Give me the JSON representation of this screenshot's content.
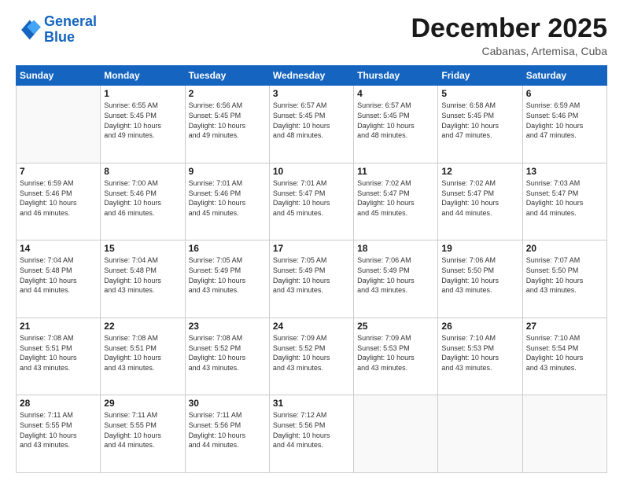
{
  "header": {
    "logo_line1": "General",
    "logo_line2": "Blue",
    "month": "December 2025",
    "location": "Cabanas, Artemisa, Cuba"
  },
  "weekdays": [
    "Sunday",
    "Monday",
    "Tuesday",
    "Wednesday",
    "Thursday",
    "Friday",
    "Saturday"
  ],
  "weeks": [
    [
      {
        "day": "",
        "info": ""
      },
      {
        "day": "1",
        "info": "Sunrise: 6:55 AM\nSunset: 5:45 PM\nDaylight: 10 hours\nand 49 minutes."
      },
      {
        "day": "2",
        "info": "Sunrise: 6:56 AM\nSunset: 5:45 PM\nDaylight: 10 hours\nand 49 minutes."
      },
      {
        "day": "3",
        "info": "Sunrise: 6:57 AM\nSunset: 5:45 PM\nDaylight: 10 hours\nand 48 minutes."
      },
      {
        "day": "4",
        "info": "Sunrise: 6:57 AM\nSunset: 5:45 PM\nDaylight: 10 hours\nand 48 minutes."
      },
      {
        "day": "5",
        "info": "Sunrise: 6:58 AM\nSunset: 5:45 PM\nDaylight: 10 hours\nand 47 minutes."
      },
      {
        "day": "6",
        "info": "Sunrise: 6:59 AM\nSunset: 5:46 PM\nDaylight: 10 hours\nand 47 minutes."
      }
    ],
    [
      {
        "day": "7",
        "info": "Sunrise: 6:59 AM\nSunset: 5:46 PM\nDaylight: 10 hours\nand 46 minutes."
      },
      {
        "day": "8",
        "info": "Sunrise: 7:00 AM\nSunset: 5:46 PM\nDaylight: 10 hours\nand 46 minutes."
      },
      {
        "day": "9",
        "info": "Sunrise: 7:01 AM\nSunset: 5:46 PM\nDaylight: 10 hours\nand 45 minutes."
      },
      {
        "day": "10",
        "info": "Sunrise: 7:01 AM\nSunset: 5:47 PM\nDaylight: 10 hours\nand 45 minutes."
      },
      {
        "day": "11",
        "info": "Sunrise: 7:02 AM\nSunset: 5:47 PM\nDaylight: 10 hours\nand 45 minutes."
      },
      {
        "day": "12",
        "info": "Sunrise: 7:02 AM\nSunset: 5:47 PM\nDaylight: 10 hours\nand 44 minutes."
      },
      {
        "day": "13",
        "info": "Sunrise: 7:03 AM\nSunset: 5:47 PM\nDaylight: 10 hours\nand 44 minutes."
      }
    ],
    [
      {
        "day": "14",
        "info": "Sunrise: 7:04 AM\nSunset: 5:48 PM\nDaylight: 10 hours\nand 44 minutes."
      },
      {
        "day": "15",
        "info": "Sunrise: 7:04 AM\nSunset: 5:48 PM\nDaylight: 10 hours\nand 43 minutes."
      },
      {
        "day": "16",
        "info": "Sunrise: 7:05 AM\nSunset: 5:49 PM\nDaylight: 10 hours\nand 43 minutes."
      },
      {
        "day": "17",
        "info": "Sunrise: 7:05 AM\nSunset: 5:49 PM\nDaylight: 10 hours\nand 43 minutes."
      },
      {
        "day": "18",
        "info": "Sunrise: 7:06 AM\nSunset: 5:49 PM\nDaylight: 10 hours\nand 43 minutes."
      },
      {
        "day": "19",
        "info": "Sunrise: 7:06 AM\nSunset: 5:50 PM\nDaylight: 10 hours\nand 43 minutes."
      },
      {
        "day": "20",
        "info": "Sunrise: 7:07 AM\nSunset: 5:50 PM\nDaylight: 10 hours\nand 43 minutes."
      }
    ],
    [
      {
        "day": "21",
        "info": "Sunrise: 7:08 AM\nSunset: 5:51 PM\nDaylight: 10 hours\nand 43 minutes."
      },
      {
        "day": "22",
        "info": "Sunrise: 7:08 AM\nSunset: 5:51 PM\nDaylight: 10 hours\nand 43 minutes."
      },
      {
        "day": "23",
        "info": "Sunrise: 7:08 AM\nSunset: 5:52 PM\nDaylight: 10 hours\nand 43 minutes."
      },
      {
        "day": "24",
        "info": "Sunrise: 7:09 AM\nSunset: 5:52 PM\nDaylight: 10 hours\nand 43 minutes."
      },
      {
        "day": "25",
        "info": "Sunrise: 7:09 AM\nSunset: 5:53 PM\nDaylight: 10 hours\nand 43 minutes."
      },
      {
        "day": "26",
        "info": "Sunrise: 7:10 AM\nSunset: 5:53 PM\nDaylight: 10 hours\nand 43 minutes."
      },
      {
        "day": "27",
        "info": "Sunrise: 7:10 AM\nSunset: 5:54 PM\nDaylight: 10 hours\nand 43 minutes."
      }
    ],
    [
      {
        "day": "28",
        "info": "Sunrise: 7:11 AM\nSunset: 5:55 PM\nDaylight: 10 hours\nand 43 minutes."
      },
      {
        "day": "29",
        "info": "Sunrise: 7:11 AM\nSunset: 5:55 PM\nDaylight: 10 hours\nand 44 minutes."
      },
      {
        "day": "30",
        "info": "Sunrise: 7:11 AM\nSunset: 5:56 PM\nDaylight: 10 hours\nand 44 minutes."
      },
      {
        "day": "31",
        "info": "Sunrise: 7:12 AM\nSunset: 5:56 PM\nDaylight: 10 hours\nand 44 minutes."
      },
      {
        "day": "",
        "info": ""
      },
      {
        "day": "",
        "info": ""
      },
      {
        "day": "",
        "info": ""
      }
    ]
  ]
}
